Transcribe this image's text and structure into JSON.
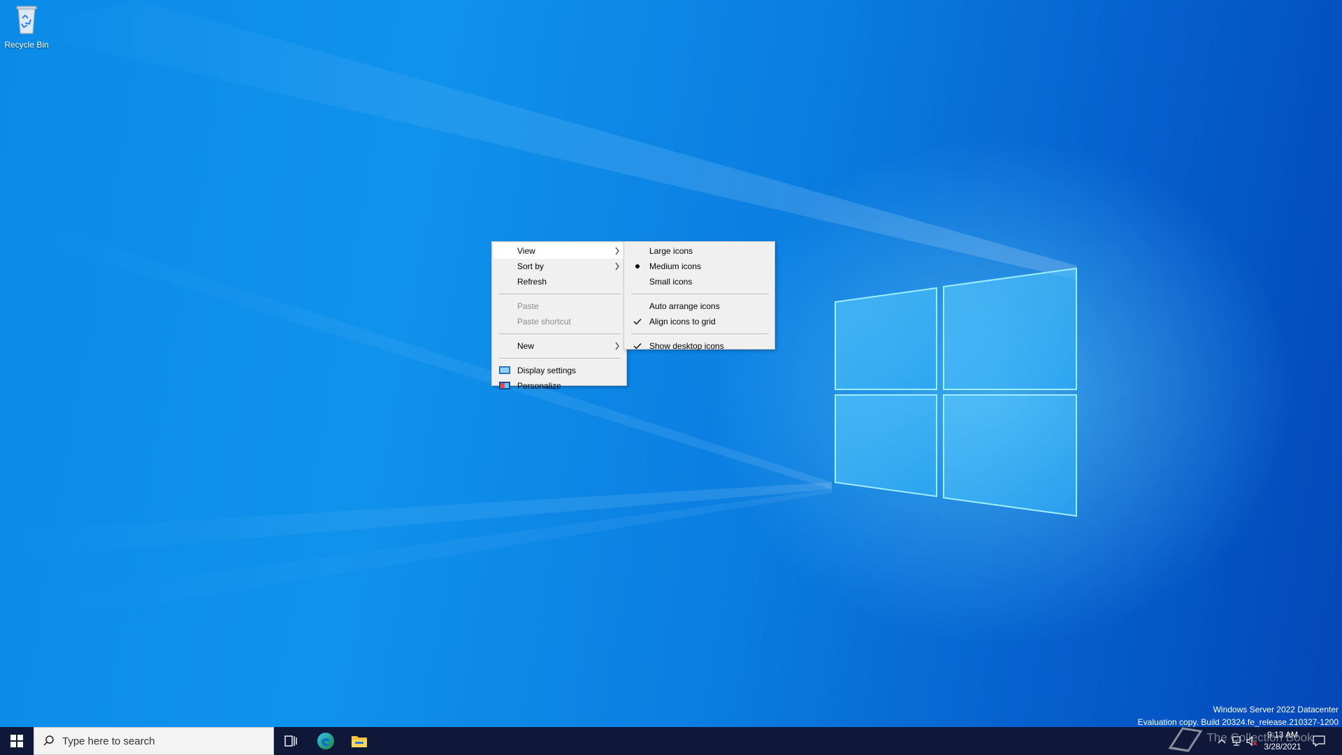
{
  "desktop": {
    "icons": [
      {
        "label": "Recycle Bin",
        "icon": "recycle-bin-icon"
      }
    ]
  },
  "context_menu": {
    "items": [
      {
        "label": "View",
        "has_submenu": true,
        "highlighted": true
      },
      {
        "label": "Sort by",
        "has_submenu": true
      },
      {
        "label": "Refresh"
      },
      {
        "label": "Paste",
        "disabled": true
      },
      {
        "label": "Paste shortcut",
        "disabled": true
      },
      {
        "label": "New",
        "has_submenu": true
      },
      {
        "label": "Display settings",
        "icon": "display-settings-icon"
      },
      {
        "label": "Personalize",
        "icon": "personalize-icon"
      }
    ]
  },
  "view_submenu": {
    "items": [
      {
        "label": "Large icons"
      },
      {
        "label": "Medium icons",
        "selected": true
      },
      {
        "label": "Small icons"
      },
      {
        "label": "Auto arrange icons"
      },
      {
        "label": "Align icons to grid",
        "checked": true
      },
      {
        "label": "Show desktop icons",
        "checked": true
      }
    ]
  },
  "watermark": {
    "line1": "Windows Server 2022 Datacenter",
    "line2": "Evaluation copy. Build 20324.fe_release.210327-1200"
  },
  "taskbar": {
    "search_placeholder": "Type here to search",
    "pinned": [
      "start-icon",
      "task-view-icon",
      "edge-icon",
      "file-explorer-icon"
    ],
    "clock": {
      "time": "9:13 AM",
      "date": "3/28/2021"
    }
  },
  "overlay_credit": "The Collection Book",
  "colors": {
    "menu_bg": "#f0f0f0",
    "menu_highlight": "#ffffff",
    "taskbar_bg": "#10183a",
    "desktop_accent": "#0a8be8"
  }
}
